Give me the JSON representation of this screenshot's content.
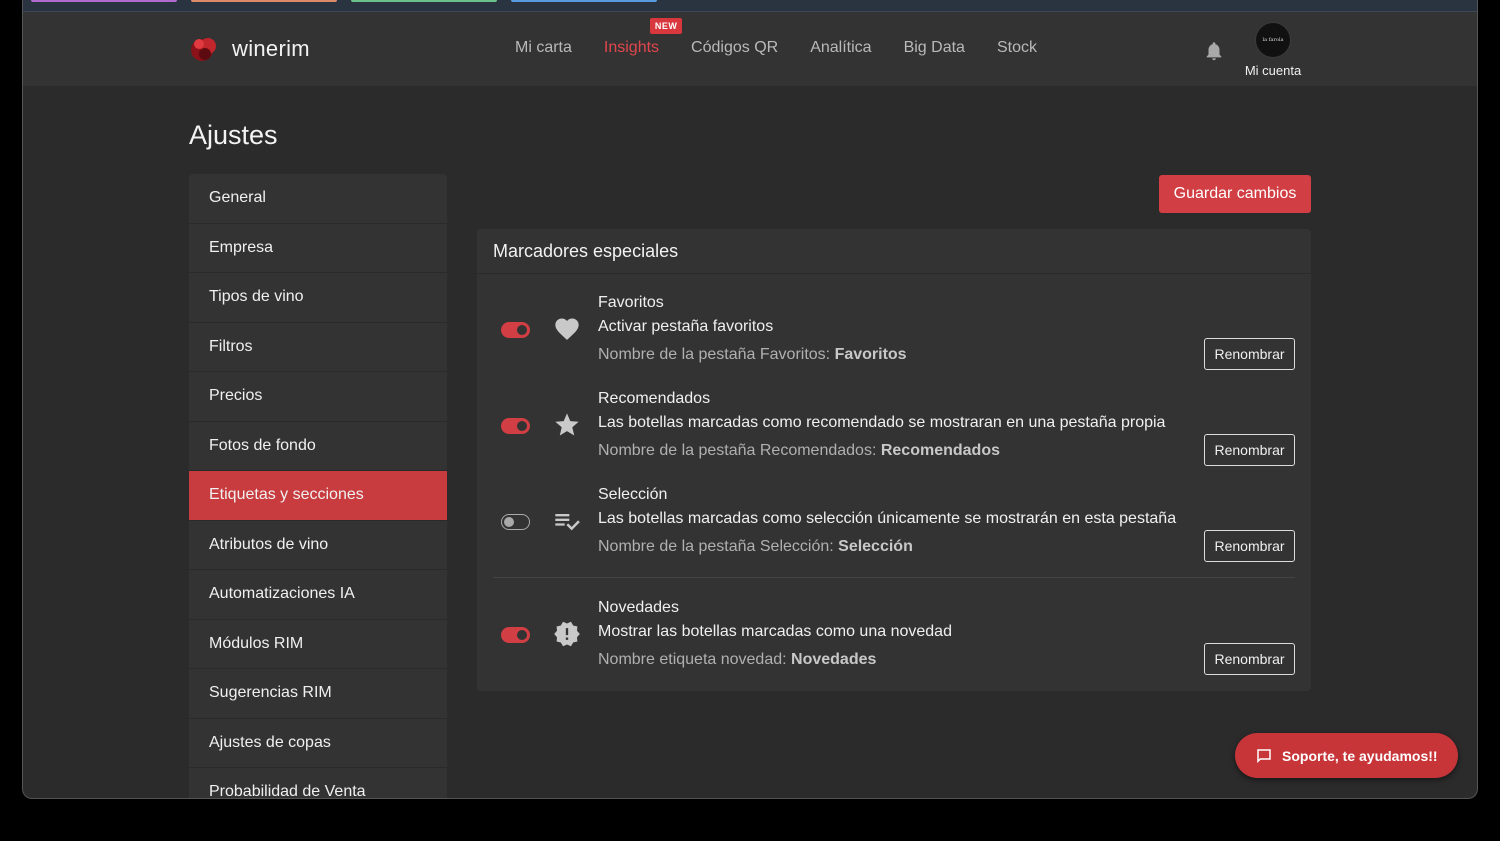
{
  "colors": {
    "accent": "#d13e43",
    "background": "#2b2b2c",
    "panel": "#333334"
  },
  "header": {
    "brand": "winerim",
    "nav": [
      {
        "label": "Mi carta",
        "active": false
      },
      {
        "label": "Insights",
        "active": true,
        "badge": "NEW"
      },
      {
        "label": "Códigos QR",
        "active": false
      },
      {
        "label": "Analítica",
        "active": false
      },
      {
        "label": "Big Data",
        "active": false
      },
      {
        "label": "Stock",
        "active": false
      }
    ],
    "account_label": "Mi cuenta",
    "avatar_text": "la farola"
  },
  "page": {
    "title": "Ajustes",
    "save_label": "Guardar cambios"
  },
  "sidebar": {
    "items": [
      {
        "label": "General"
      },
      {
        "label": "Empresa"
      },
      {
        "label": "Tipos de vino"
      },
      {
        "label": "Filtros"
      },
      {
        "label": "Precios"
      },
      {
        "label": "Fotos de fondo"
      },
      {
        "label": "Etiquetas y secciones",
        "active": true
      },
      {
        "label": "Atributos de vino"
      },
      {
        "label": "Automatizaciones IA"
      },
      {
        "label": "Módulos RIM"
      },
      {
        "label": "Sugerencias RIM"
      },
      {
        "label": "Ajustes de copas"
      },
      {
        "label": "Probabilidad de Venta"
      }
    ]
  },
  "card": {
    "title": "Marcadores especiales",
    "rows": [
      {
        "title": "Favoritos",
        "description": "Activar pestaña favoritos",
        "name_prefix": "Nombre de la pestaña Favoritos: ",
        "name_value": "Favoritos",
        "enabled": true,
        "icon": "heart-icon",
        "button": "Renombrar"
      },
      {
        "title": "Recomendados",
        "description": "Las botellas marcadas como recomendado se mostraran en una pestaña propia",
        "name_prefix": "Nombre de la pestaña Recomendados: ",
        "name_value": "Recomendados",
        "enabled": true,
        "icon": "star-icon",
        "button": "Renombrar"
      },
      {
        "title": "Selección",
        "description": "Las botellas marcadas como selección únicamente se mostrarán en esta pestaña",
        "name_prefix": "Nombre de la pestaña Selección: ",
        "name_value": "Selección",
        "enabled": false,
        "icon": "playlist-check-icon",
        "button": "Renombrar"
      },
      {
        "title": "Novedades",
        "description": "Mostrar las botellas marcadas como una novedad",
        "name_prefix": "Nombre etiqueta novedad: ",
        "name_value": "Novedades",
        "enabled": true,
        "icon": "new-releases-icon",
        "button": "Renombrar"
      }
    ]
  },
  "support": {
    "label": "Soporte, te ayudamos!!"
  }
}
